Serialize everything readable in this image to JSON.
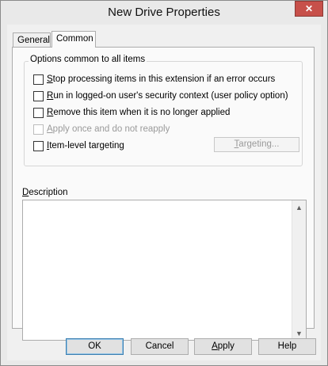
{
  "window": {
    "title": "New Drive Properties",
    "close_glyph": "✕",
    "close_color": "#c7504a"
  },
  "tabs": [
    {
      "label": "General",
      "active": false
    },
    {
      "label": "Common",
      "active": true
    }
  ],
  "options_group": {
    "title": "Options common to all items",
    "items": [
      {
        "mnemonic": "S",
        "rest": "top processing items in this extension if an error occurs",
        "checked": false,
        "enabled": true
      },
      {
        "mnemonic": "R",
        "rest": "un in logged-on user's security context (user policy option)",
        "checked": false,
        "enabled": true
      },
      {
        "mnemonic": "R",
        "rest": "emove this item when it is no longer applied",
        "checked": false,
        "enabled": true
      },
      {
        "mnemonic": "A",
        "rest": "pply once and do not reapply",
        "checked": false,
        "enabled": false
      },
      {
        "mnemonic": "I",
        "rest": "tem-level targeting",
        "checked": false,
        "enabled": true
      }
    ],
    "targeting_button": {
      "mnemonic": "T",
      "rest": "argeting...",
      "enabled": false
    }
  },
  "description": {
    "label_mnemonic": "D",
    "label_rest": "escription",
    "value": ""
  },
  "buttons": {
    "ok": "OK",
    "cancel": "Cancel",
    "apply_mnemonic": "A",
    "apply_rest": "pply",
    "help": "Help"
  }
}
